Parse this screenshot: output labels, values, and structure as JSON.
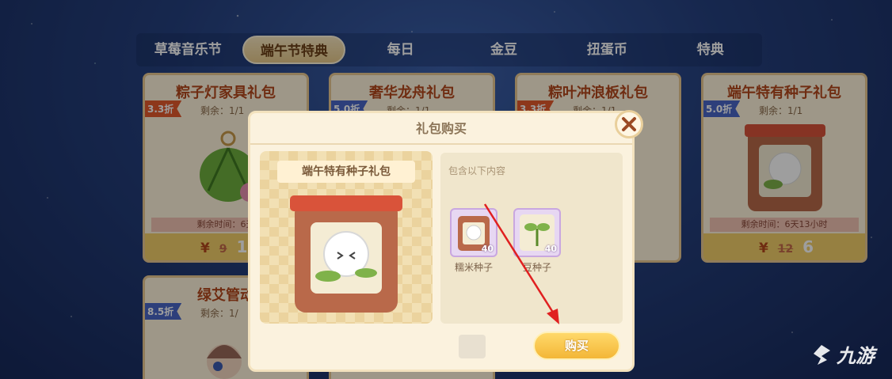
{
  "tabs": [
    {
      "label": "草莓音乐节",
      "active": false
    },
    {
      "label": "端午节特典",
      "active": true
    },
    {
      "label": "每日",
      "active": false
    },
    {
      "label": "金豆",
      "active": false
    },
    {
      "label": "扭蛋币",
      "active": false
    },
    {
      "label": "特典",
      "active": false
    }
  ],
  "cards": [
    {
      "title": "粽子灯家具礼包",
      "discount": "3.3折",
      "remain": "剩余：1/1",
      "time": "剩余时间：6天",
      "price_symbol": "¥",
      "old_price": "9",
      "new_price": "1"
    },
    {
      "title": "奢华龙舟礼包",
      "discount": "5.0折",
      "remain": "剩余：1/1"
    },
    {
      "title": "粽叶冲浪板礼包",
      "discount": "3.3折",
      "remain": "剩余：1/1"
    },
    {
      "title": "端午特有种子礼包",
      "discount": "5.0折",
      "remain": "剩余：1/1",
      "time": "剩余时间：6天13小时",
      "price_symbol": "¥",
      "old_price": "12",
      "new_price": "6"
    },
    {
      "title": "绿艾管动",
      "discount": "8.5折",
      "remain": "剩余：1/"
    }
  ],
  "dialog": {
    "title": "礼包购买",
    "package_name": "端午特有种子礼包",
    "contains_label": "包含以下内容",
    "items": [
      {
        "name": "糯米种子",
        "count": "40",
        "icon": "rice-seed-bag-icon"
      },
      {
        "name": "豆种子",
        "count": "40",
        "icon": "bean-sprout-icon"
      }
    ],
    "buy_label": "购买",
    "close_icon": "close-x-icon"
  },
  "watermark": {
    "text": "九游",
    "icon": "jiuyou-logo-icon"
  },
  "colors": {
    "accent": "#f3b637",
    "close": "#9b4a24",
    "discount_red": "#e45a2d",
    "discount_blue": "#4a67c7",
    "arrow": "#e02020"
  }
}
